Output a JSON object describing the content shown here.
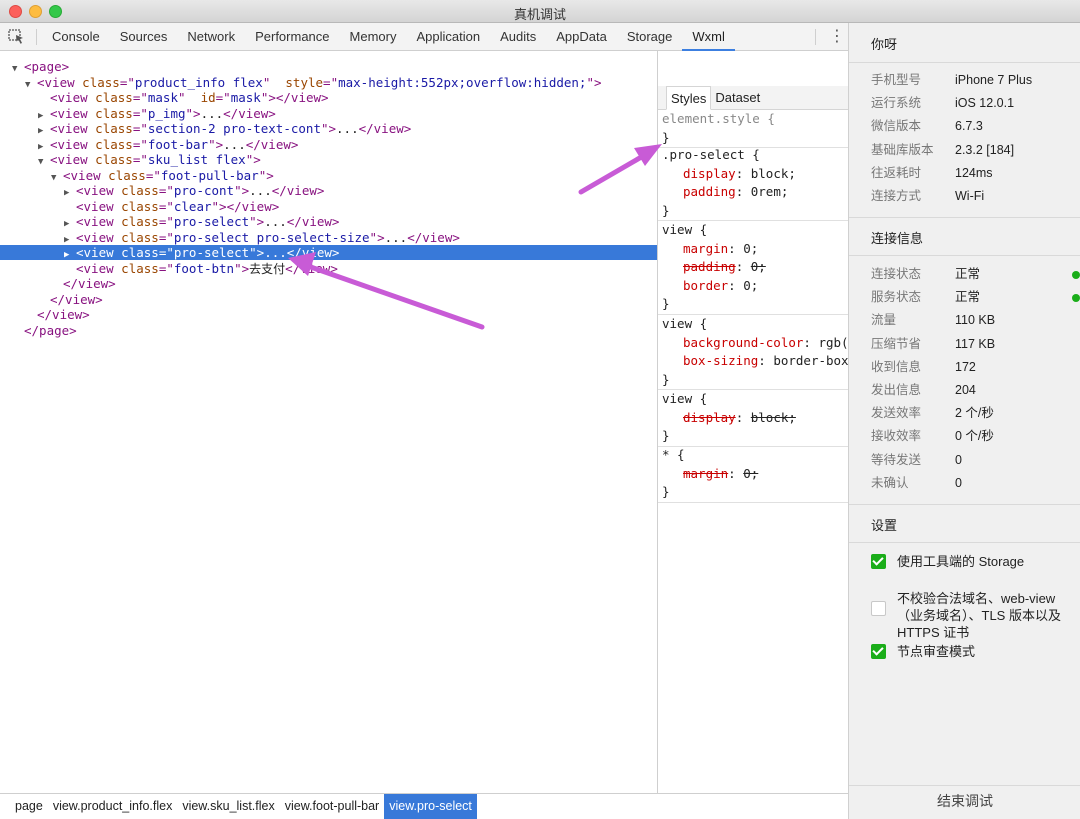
{
  "window": {
    "title": "真机调试"
  },
  "tabs": [
    "Console",
    "Sources",
    "Network",
    "Performance",
    "Memory",
    "Application",
    "Audits",
    "AppData",
    "Storage",
    "Wxml"
  ],
  "active_tab": "Wxml",
  "tree": [
    {
      "indent": 0,
      "tri": "▼",
      "parts": [
        [
          "tag",
          "<page>"
        ]
      ]
    },
    {
      "indent": 1,
      "tri": "▼",
      "parts": [
        [
          "tag",
          "<view"
        ],
        [
          "sp",
          " "
        ],
        [
          "attr-name",
          "class"
        ],
        [
          "tag",
          "=\""
        ],
        [
          "attr-val",
          "product_info flex"
        ],
        [
          "tag",
          "\""
        ],
        [
          "sp",
          "  "
        ],
        [
          "attr-name",
          "style"
        ],
        [
          "tag",
          "=\""
        ],
        [
          "attr-val",
          "max-height:552px;overflow:hidden;"
        ],
        [
          "tag",
          "\">"
        ]
      ]
    },
    {
      "indent": 2,
      "tri": "",
      "parts": [
        [
          "tag",
          "<view"
        ],
        [
          "sp",
          " "
        ],
        [
          "attr-name",
          "class"
        ],
        [
          "tag",
          "=\""
        ],
        [
          "attr-val",
          "mask"
        ],
        [
          "tag",
          "\""
        ],
        [
          "sp",
          "  "
        ],
        [
          "attr-name",
          "id"
        ],
        [
          "tag",
          "=\""
        ],
        [
          "attr-val",
          "mask"
        ],
        [
          "tag",
          "\"></view>"
        ]
      ]
    },
    {
      "indent": 2,
      "tri": "▶",
      "parts": [
        [
          "tag",
          "<view"
        ],
        [
          "sp",
          " "
        ],
        [
          "attr-name",
          "class"
        ],
        [
          "tag",
          "=\""
        ],
        [
          "attr-val",
          "p_img"
        ],
        [
          "tag",
          "\">"
        ],
        [
          "ell",
          "..."
        ],
        [
          "tag",
          "</view>"
        ]
      ]
    },
    {
      "indent": 2,
      "tri": "▶",
      "parts": [
        [
          "tag",
          "<view"
        ],
        [
          "sp",
          " "
        ],
        [
          "attr-name",
          "class"
        ],
        [
          "tag",
          "=\""
        ],
        [
          "attr-val",
          "section-2 pro-text-cont"
        ],
        [
          "tag",
          "\">"
        ],
        [
          "ell",
          "..."
        ],
        [
          "tag",
          "</view>"
        ]
      ]
    },
    {
      "indent": 2,
      "tri": "▶",
      "parts": [
        [
          "tag",
          "<view"
        ],
        [
          "sp",
          " "
        ],
        [
          "attr-name",
          "class"
        ],
        [
          "tag",
          "=\""
        ],
        [
          "attr-val",
          "foot-bar"
        ],
        [
          "tag",
          "\">"
        ],
        [
          "ell",
          "..."
        ],
        [
          "tag",
          "</view>"
        ]
      ]
    },
    {
      "indent": 2,
      "tri": "▼",
      "parts": [
        [
          "tag",
          "<view"
        ],
        [
          "sp",
          " "
        ],
        [
          "attr-name",
          "class"
        ],
        [
          "tag",
          "=\""
        ],
        [
          "attr-val",
          "sku_list flex"
        ],
        [
          "tag",
          "\">"
        ]
      ]
    },
    {
      "indent": 3,
      "tri": "▼",
      "parts": [
        [
          "tag",
          "<view"
        ],
        [
          "sp",
          " "
        ],
        [
          "attr-name",
          "class"
        ],
        [
          "tag",
          "=\""
        ],
        [
          "attr-val",
          "foot-pull-bar"
        ],
        [
          "tag",
          "\">"
        ]
      ]
    },
    {
      "indent": 4,
      "tri": "▶",
      "parts": [
        [
          "tag",
          "<view"
        ],
        [
          "sp",
          " "
        ],
        [
          "attr-name",
          "class"
        ],
        [
          "tag",
          "=\""
        ],
        [
          "attr-val",
          "pro-cont"
        ],
        [
          "tag",
          "\">"
        ],
        [
          "ell",
          "..."
        ],
        [
          "tag",
          "</view>"
        ]
      ]
    },
    {
      "indent": 4,
      "tri": "",
      "parts": [
        [
          "tag",
          "<view"
        ],
        [
          "sp",
          " "
        ],
        [
          "attr-name",
          "class"
        ],
        [
          "tag",
          "=\""
        ],
        [
          "attr-val",
          "clear"
        ],
        [
          "tag",
          "\"></view>"
        ]
      ]
    },
    {
      "indent": 4,
      "tri": "▶",
      "parts": [
        [
          "tag",
          "<view"
        ],
        [
          "sp",
          " "
        ],
        [
          "attr-name",
          "class"
        ],
        [
          "tag",
          "=\""
        ],
        [
          "attr-val",
          "pro-select"
        ],
        [
          "tag",
          "\">"
        ],
        [
          "ell",
          "..."
        ],
        [
          "tag",
          "</view>"
        ]
      ]
    },
    {
      "indent": 4,
      "tri": "▶",
      "parts": [
        [
          "tag",
          "<view"
        ],
        [
          "sp",
          " "
        ],
        [
          "attr-name",
          "class"
        ],
        [
          "tag",
          "=\""
        ],
        [
          "attr-val",
          "pro-select pro-select-size"
        ],
        [
          "tag",
          "\">"
        ],
        [
          "ell",
          "..."
        ],
        [
          "tag",
          "</view>"
        ]
      ]
    },
    {
      "indent": 4,
      "tri": "▶",
      "selected": true,
      "parts": [
        [
          "tag",
          "<view"
        ],
        [
          "sp",
          " "
        ],
        [
          "attr-name",
          "class"
        ],
        [
          "tag",
          "=\""
        ],
        [
          "attr-val",
          "pro-select"
        ],
        [
          "tag",
          "\">"
        ],
        [
          "ell",
          "..."
        ],
        [
          "tag",
          "</view>"
        ]
      ]
    },
    {
      "indent": 4,
      "tri": "",
      "parts": [
        [
          "tag",
          "<view"
        ],
        [
          "sp",
          " "
        ],
        [
          "attr-name",
          "class"
        ],
        [
          "tag",
          "=\""
        ],
        [
          "attr-val",
          "foot-btn"
        ],
        [
          "tag",
          "\">"
        ],
        [
          "txt",
          "去支付"
        ],
        [
          "tag",
          "</view>"
        ]
      ]
    },
    {
      "indent": 3,
      "tri": "",
      "parts": [
        [
          "tag",
          "</view>"
        ]
      ]
    },
    {
      "indent": 2,
      "tri": "",
      "parts": [
        [
          "tag",
          "</view>"
        ]
      ]
    },
    {
      "indent": 1,
      "tri": "",
      "parts": [
        [
          "tag",
          "</view>"
        ]
      ]
    },
    {
      "indent": 0,
      "tri": "",
      "parts": [
        [
          "tag",
          "</page>"
        ]
      ]
    }
  ],
  "breadcrumbs": [
    "page",
    "view.product_info.flex",
    "view.sku_list.flex",
    "view.foot-pull-bar",
    "view.pro-select"
  ],
  "styles": {
    "tabs": [
      "Styles",
      "Dataset"
    ],
    "rules": [
      {
        "selector": "element.style {",
        "dim": true,
        "props": []
      },
      {
        "selector": ".pro-select {",
        "props": [
          {
            "name": "display",
            "value": "block;",
            "strike": false
          },
          {
            "name": "padding",
            "value": "0rem;",
            "strike": false
          }
        ]
      },
      {
        "selector": "view {",
        "props": [
          {
            "name": "margin",
            "value": "0;",
            "strike": false
          },
          {
            "name": "padding",
            "value": "0;",
            "strike": true
          },
          {
            "name": "border",
            "value": "0;",
            "strike": false
          }
        ]
      },
      {
        "selector": "view {",
        "props": [
          {
            "name": "background-color",
            "value": "rgb(",
            "strike": false
          },
          {
            "name": "box-sizing",
            "value": "border-box",
            "strike": false
          }
        ]
      },
      {
        "selector": "view {",
        "props": [
          {
            "name": "display",
            "value": "block;",
            "strike": true
          }
        ]
      },
      {
        "selector": "* {",
        "props": [
          {
            "name": "margin",
            "value": "0;",
            "strike": true
          }
        ]
      }
    ]
  },
  "side": {
    "title": "你呀",
    "device_info": [
      {
        "k": "手机型号",
        "v": "iPhone 7 Plus"
      },
      {
        "k": "运行系统",
        "v": "iOS 12.0.1"
      },
      {
        "k": "微信版本",
        "v": "6.7.3"
      },
      {
        "k": "基础库版本",
        "v": "2.3.2 [184]"
      },
      {
        "k": "往返耗时",
        "v": "124ms"
      },
      {
        "k": "连接方式",
        "v": "Wi-Fi"
      }
    ],
    "connection_title": "连接信息",
    "connection_info": [
      {
        "k": "连接状态",
        "v": "正常",
        "dot": true
      },
      {
        "k": "服务状态",
        "v": "正常",
        "dot": true
      },
      {
        "k": "流量",
        "v": "110 KB"
      },
      {
        "k": "压缩节省",
        "v": "117 KB"
      },
      {
        "k": "收到信息",
        "v": "172"
      },
      {
        "k": "发出信息",
        "v": "204"
      },
      {
        "k": "发送效率",
        "v": "2 个/秒"
      },
      {
        "k": "接收效率",
        "v": "0 个/秒"
      },
      {
        "k": "等待发送",
        "v": "0"
      },
      {
        "k": "未确认",
        "v": "0"
      }
    ],
    "settings_title": "设置",
    "settings": [
      {
        "label": "使用工具端的 Storage",
        "checked": true
      },
      {
        "label": "不校验合法域名、web-view（业务域名）、TLS 版本以及 HTTPS 证书",
        "checked": false
      },
      {
        "label": "节点审查模式",
        "checked": true
      }
    ],
    "end_button": "结束调试"
  },
  "colors": {
    "accent": "#3879d9",
    "status_ok": "#1aad19",
    "annotation": "#c85bd6"
  }
}
